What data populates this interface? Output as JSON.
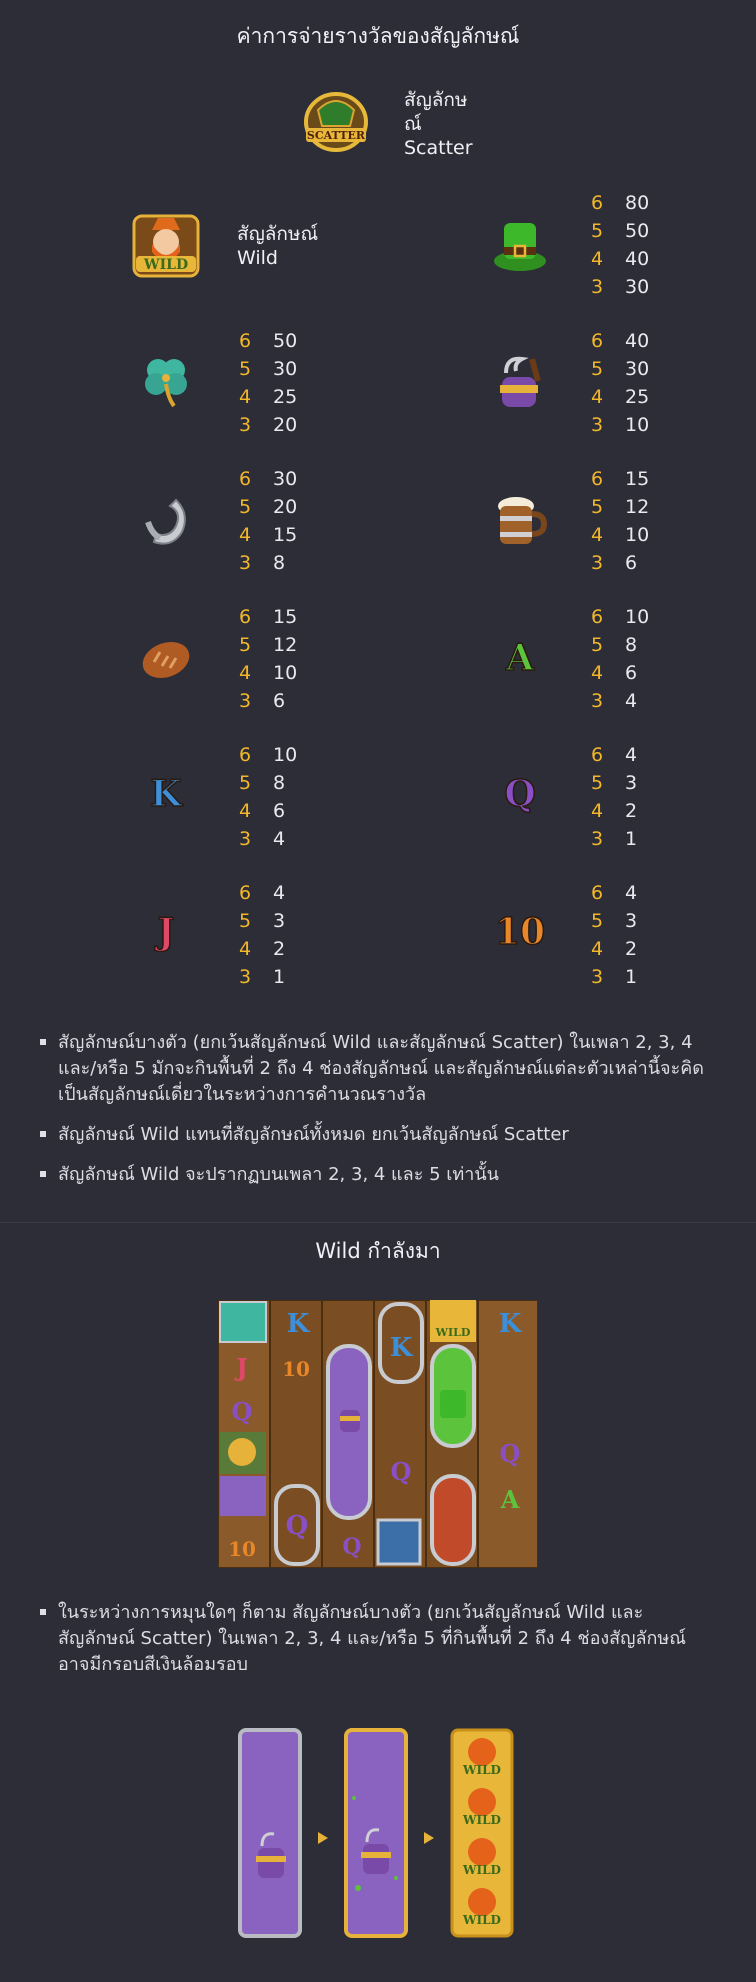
{
  "page": {
    "title": "ค่าการจ่ายรางวัลของสัญลักษณ์",
    "wild_section_title": "Wild กำลังมา"
  },
  "scatter": {
    "icon_text": "SCATTER",
    "label_line1": "สัญลักษ",
    "label_line2": "ณ์",
    "label_line3": "Scatter"
  },
  "wild": {
    "icon_text": "WILD",
    "label_line1": "สัญลักษณ์",
    "label_line2": "Wild"
  },
  "symbols": [
    {
      "name": "hat",
      "glyph": "hat-icon",
      "pays": [
        {
          "n": "6",
          "v": "80"
        },
        {
          "n": "5",
          "v": "50"
        },
        {
          "n": "4",
          "v": "40"
        },
        {
          "n": "3",
          "v": "30"
        }
      ]
    },
    {
      "name": "clover",
      "glyph": "clover-icon",
      "pays": [
        {
          "n": "6",
          "v": "50"
        },
        {
          "n": "5",
          "v": "30"
        },
        {
          "n": "4",
          "v": "25"
        },
        {
          "n": "3",
          "v": "20"
        }
      ]
    },
    {
      "name": "pipe",
      "glyph": "pipe-icon",
      "pays": [
        {
          "n": "6",
          "v": "40"
        },
        {
          "n": "5",
          "v": "30"
        },
        {
          "n": "4",
          "v": "25"
        },
        {
          "n": "3",
          "v": "10"
        }
      ]
    },
    {
      "name": "horseshoe",
      "glyph": "horseshoe-icon",
      "pays": [
        {
          "n": "6",
          "v": "30"
        },
        {
          "n": "5",
          "v": "20"
        },
        {
          "n": "4",
          "v": "15"
        },
        {
          "n": "3",
          "v": "8"
        }
      ]
    },
    {
      "name": "beer",
      "glyph": "beer-mug-icon",
      "pays": [
        {
          "n": "6",
          "v": "15"
        },
        {
          "n": "5",
          "v": "12"
        },
        {
          "n": "4",
          "v": "10"
        },
        {
          "n": "3",
          "v": "6"
        }
      ]
    },
    {
      "name": "bread",
      "glyph": "bread-icon",
      "pays": [
        {
          "n": "6",
          "v": "15"
        },
        {
          "n": "5",
          "v": "12"
        },
        {
          "n": "4",
          "v": "10"
        },
        {
          "n": "3",
          "v": "6"
        }
      ]
    },
    {
      "name": "A",
      "glyph": "A",
      "pays": [
        {
          "n": "6",
          "v": "10"
        },
        {
          "n": "5",
          "v": "8"
        },
        {
          "n": "4",
          "v": "6"
        },
        {
          "n": "3",
          "v": "4"
        }
      ]
    },
    {
      "name": "K",
      "glyph": "K",
      "pays": [
        {
          "n": "6",
          "v": "10"
        },
        {
          "n": "5",
          "v": "8"
        },
        {
          "n": "4",
          "v": "6"
        },
        {
          "n": "3",
          "v": "4"
        }
      ]
    },
    {
      "name": "Q",
      "glyph": "Q",
      "pays": [
        {
          "n": "6",
          "v": "4"
        },
        {
          "n": "5",
          "v": "3"
        },
        {
          "n": "4",
          "v": "2"
        },
        {
          "n": "3",
          "v": "1"
        }
      ]
    },
    {
      "name": "J",
      "glyph": "J",
      "pays": [
        {
          "n": "6",
          "v": "4"
        },
        {
          "n": "5",
          "v": "3"
        },
        {
          "n": "4",
          "v": "2"
        },
        {
          "n": "3",
          "v": "1"
        }
      ]
    },
    {
      "name": "10",
      "glyph": "10",
      "pays": [
        {
          "n": "6",
          "v": "4"
        },
        {
          "n": "5",
          "v": "3"
        },
        {
          "n": "4",
          "v": "2"
        },
        {
          "n": "3",
          "v": "1"
        }
      ]
    }
  ],
  "rules": [
    "สัญลักษณ์บางตัว (ยกเว้นสัญลักษณ์ Wild และสัญลักษณ์ Scatter) ในเพลา 2, 3, 4 และ/หรือ 5 มักจะกินพื้นที่ 2 ถึง 4 ช่องสัญลักษณ์ และสัญลักษณ์แต่ละตัวเหล่านี้จะคิดเป็นสัญลักษณ์เดี่ยวในระหว่างการคำนวณรางวัล",
    "สัญลักษณ์ Wild แทนที่สัญลักษณ์ทั้งหมด ยกเว้นสัญลักษณ์ Scatter",
    "สัญลักษณ์ Wild จะปรากฏบนเพลา 2, 3, 4 และ 5 เท่านั้น"
  ],
  "wild_rules": [
    "ในระหว่างการหมุนใดๆ ก็ตาม สัญลักษณ์บางตัว (ยกเว้นสัญลักษณ์ Wild และสัญลักษณ์ Scatter) ในเพลา 2, 3, 4 และ/หรือ 5 ที่กินพื้นที่ 2 ถึง 4 ช่องสัญลักษณ์ อาจมีกรอบสีเงินล้อมรอบ"
  ],
  "grid_letters": {
    "k": "K",
    "q": "Q",
    "j": "J",
    "ten": "10",
    "a": "A",
    "wild": "WILD"
  },
  "colors": {
    "background": "#2c2d37",
    "accent": "#f3b829",
    "text": "#e9e9ee"
  }
}
